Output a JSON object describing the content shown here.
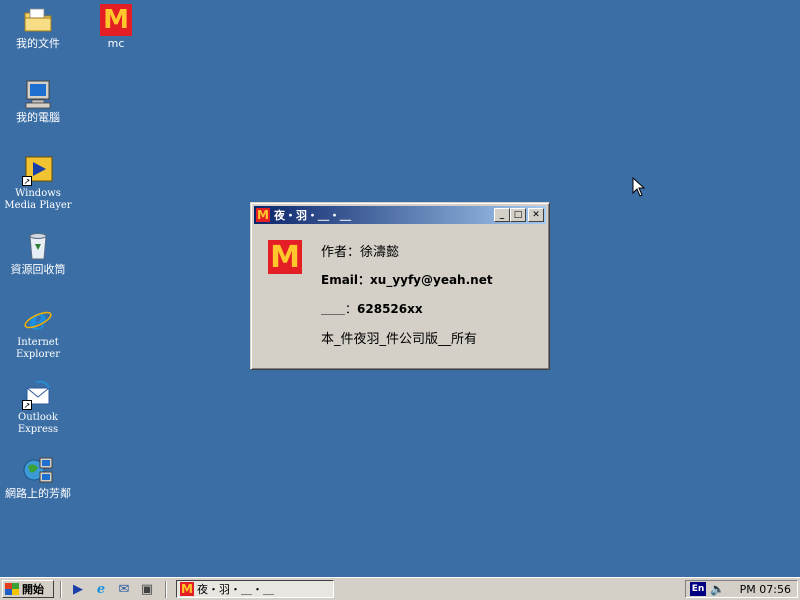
{
  "desktop": {
    "icons": [
      {
        "label": "我的文件",
        "icon": "folder-icon"
      },
      {
        "label": "mc",
        "icon": "mcdonalds-logo-icon"
      },
      {
        "label": "我的電腦",
        "icon": "computer-icon"
      },
      {
        "label": "Windows\nMedia Player",
        "icon": "media-player-icon"
      },
      {
        "label": "資源回收筒",
        "icon": "recycle-bin-icon"
      },
      {
        "label": "Internet\nExplorer",
        "icon": "internet-explorer-icon"
      },
      {
        "label": "Outlook\nExpress",
        "icon": "outlook-express-icon"
      },
      {
        "label": "網路上的芳鄰",
        "icon": "network-neighborhood-icon"
      }
    ]
  },
  "window": {
    "title": "夜・羽・＿・＿",
    "logo_letter": "M",
    "buttons": {
      "minimize": "_",
      "maximize": "□",
      "close": "✕"
    },
    "lines": {
      "author": "作者：徐濤懿",
      "email_label": "Email：",
      "email_value": "xu_yyfy@yeah.net",
      "qq_label": "＿＿：",
      "qq_value": "628526xx",
      "copyright": "本_件夜羽_件公司版__所有"
    }
  },
  "taskbar": {
    "start_label": "開始",
    "task_button": "夜・羽・＿・＿",
    "tray": {
      "lang": "En",
      "clock": "PM 07:56"
    }
  },
  "colors": {
    "desktop": "#3b6ea5",
    "title_start": "#0a246a",
    "mc_red": "#e41e25",
    "mc_yellow": "#ffc72c"
  }
}
